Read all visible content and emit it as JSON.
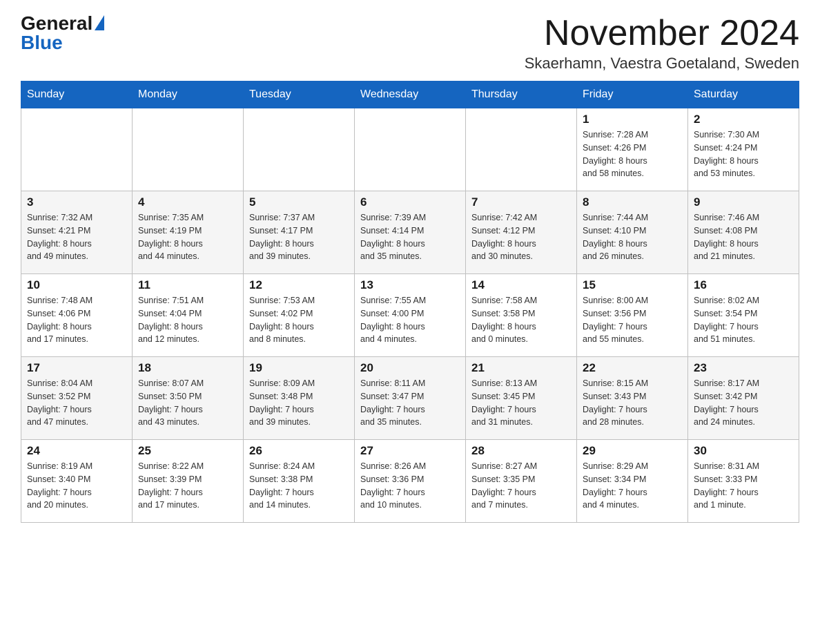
{
  "logo": {
    "general": "General",
    "blue": "Blue"
  },
  "title": "November 2024",
  "location": "Skaerhamn, Vaestra Goetaland, Sweden",
  "days_of_week": [
    "Sunday",
    "Monday",
    "Tuesday",
    "Wednesday",
    "Thursday",
    "Friday",
    "Saturday"
  ],
  "weeks": [
    {
      "days": [
        {
          "number": "",
          "info": ""
        },
        {
          "number": "",
          "info": ""
        },
        {
          "number": "",
          "info": ""
        },
        {
          "number": "",
          "info": ""
        },
        {
          "number": "",
          "info": ""
        },
        {
          "number": "1",
          "info": "Sunrise: 7:28 AM\nSunset: 4:26 PM\nDaylight: 8 hours\nand 58 minutes."
        },
        {
          "number": "2",
          "info": "Sunrise: 7:30 AM\nSunset: 4:24 PM\nDaylight: 8 hours\nand 53 minutes."
        }
      ]
    },
    {
      "days": [
        {
          "number": "3",
          "info": "Sunrise: 7:32 AM\nSunset: 4:21 PM\nDaylight: 8 hours\nand 49 minutes."
        },
        {
          "number": "4",
          "info": "Sunrise: 7:35 AM\nSunset: 4:19 PM\nDaylight: 8 hours\nand 44 minutes."
        },
        {
          "number": "5",
          "info": "Sunrise: 7:37 AM\nSunset: 4:17 PM\nDaylight: 8 hours\nand 39 minutes."
        },
        {
          "number": "6",
          "info": "Sunrise: 7:39 AM\nSunset: 4:14 PM\nDaylight: 8 hours\nand 35 minutes."
        },
        {
          "number": "7",
          "info": "Sunrise: 7:42 AM\nSunset: 4:12 PM\nDaylight: 8 hours\nand 30 minutes."
        },
        {
          "number": "8",
          "info": "Sunrise: 7:44 AM\nSunset: 4:10 PM\nDaylight: 8 hours\nand 26 minutes."
        },
        {
          "number": "9",
          "info": "Sunrise: 7:46 AM\nSunset: 4:08 PM\nDaylight: 8 hours\nand 21 minutes."
        }
      ]
    },
    {
      "days": [
        {
          "number": "10",
          "info": "Sunrise: 7:48 AM\nSunset: 4:06 PM\nDaylight: 8 hours\nand 17 minutes."
        },
        {
          "number": "11",
          "info": "Sunrise: 7:51 AM\nSunset: 4:04 PM\nDaylight: 8 hours\nand 12 minutes."
        },
        {
          "number": "12",
          "info": "Sunrise: 7:53 AM\nSunset: 4:02 PM\nDaylight: 8 hours\nand 8 minutes."
        },
        {
          "number": "13",
          "info": "Sunrise: 7:55 AM\nSunset: 4:00 PM\nDaylight: 8 hours\nand 4 minutes."
        },
        {
          "number": "14",
          "info": "Sunrise: 7:58 AM\nSunset: 3:58 PM\nDaylight: 8 hours\nand 0 minutes."
        },
        {
          "number": "15",
          "info": "Sunrise: 8:00 AM\nSunset: 3:56 PM\nDaylight: 7 hours\nand 55 minutes."
        },
        {
          "number": "16",
          "info": "Sunrise: 8:02 AM\nSunset: 3:54 PM\nDaylight: 7 hours\nand 51 minutes."
        }
      ]
    },
    {
      "days": [
        {
          "number": "17",
          "info": "Sunrise: 8:04 AM\nSunset: 3:52 PM\nDaylight: 7 hours\nand 47 minutes."
        },
        {
          "number": "18",
          "info": "Sunrise: 8:07 AM\nSunset: 3:50 PM\nDaylight: 7 hours\nand 43 minutes."
        },
        {
          "number": "19",
          "info": "Sunrise: 8:09 AM\nSunset: 3:48 PM\nDaylight: 7 hours\nand 39 minutes."
        },
        {
          "number": "20",
          "info": "Sunrise: 8:11 AM\nSunset: 3:47 PM\nDaylight: 7 hours\nand 35 minutes."
        },
        {
          "number": "21",
          "info": "Sunrise: 8:13 AM\nSunset: 3:45 PM\nDaylight: 7 hours\nand 31 minutes."
        },
        {
          "number": "22",
          "info": "Sunrise: 8:15 AM\nSunset: 3:43 PM\nDaylight: 7 hours\nand 28 minutes."
        },
        {
          "number": "23",
          "info": "Sunrise: 8:17 AM\nSunset: 3:42 PM\nDaylight: 7 hours\nand 24 minutes."
        }
      ]
    },
    {
      "days": [
        {
          "number": "24",
          "info": "Sunrise: 8:19 AM\nSunset: 3:40 PM\nDaylight: 7 hours\nand 20 minutes."
        },
        {
          "number": "25",
          "info": "Sunrise: 8:22 AM\nSunset: 3:39 PM\nDaylight: 7 hours\nand 17 minutes."
        },
        {
          "number": "26",
          "info": "Sunrise: 8:24 AM\nSunset: 3:38 PM\nDaylight: 7 hours\nand 14 minutes."
        },
        {
          "number": "27",
          "info": "Sunrise: 8:26 AM\nSunset: 3:36 PM\nDaylight: 7 hours\nand 10 minutes."
        },
        {
          "number": "28",
          "info": "Sunrise: 8:27 AM\nSunset: 3:35 PM\nDaylight: 7 hours\nand 7 minutes."
        },
        {
          "number": "29",
          "info": "Sunrise: 8:29 AM\nSunset: 3:34 PM\nDaylight: 7 hours\nand 4 minutes."
        },
        {
          "number": "30",
          "info": "Sunrise: 8:31 AM\nSunset: 3:33 PM\nDaylight: 7 hours\nand 1 minute."
        }
      ]
    }
  ]
}
